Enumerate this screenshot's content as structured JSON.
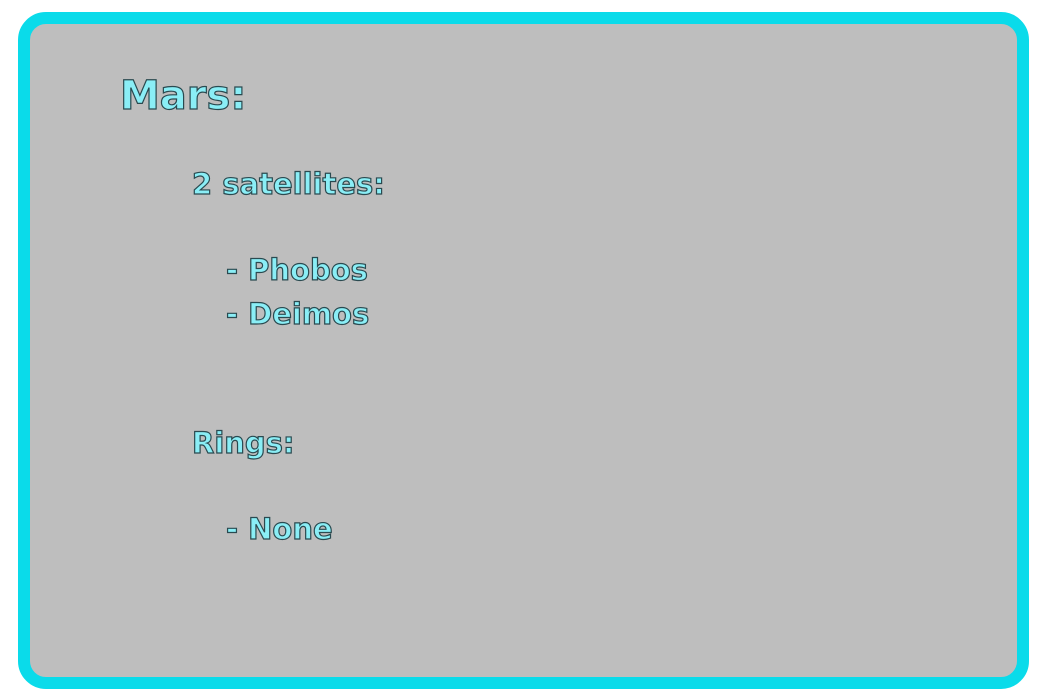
{
  "card": {
    "title": "Mars:",
    "satellites": {
      "heading": "2 satellites:",
      "items": [
        "- Phobos",
        "- Deimos"
      ]
    },
    "rings": {
      "heading": "Rings:",
      "items": [
        "- None"
      ]
    }
  },
  "colors": {
    "border": "#0adbea",
    "background": "#bebebe",
    "text_fill": "#8aeef6",
    "text_outline": "#2a4a50"
  }
}
